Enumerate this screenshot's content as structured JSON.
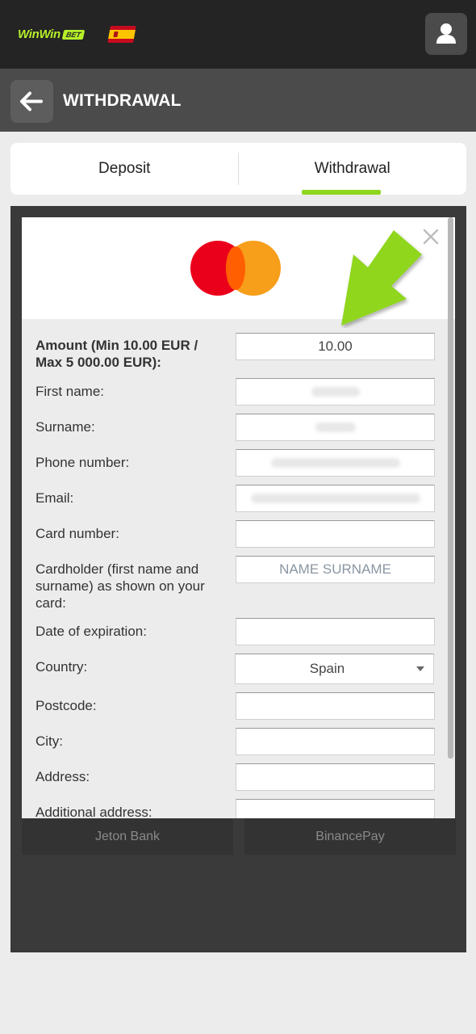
{
  "brand": {
    "name": "WinWin",
    "badge": "BET",
    "accent": "#b6f02a"
  },
  "header": {
    "title": "WITHDRAWAL",
    "back_icon": "arrow-left-icon",
    "user_icon": "user-icon"
  },
  "tabs": [
    {
      "label": "Deposit",
      "active": false
    },
    {
      "label": "Withdrawal",
      "active": true
    }
  ],
  "background_methods": [
    "Jeton Bank",
    "BinancePay"
  ],
  "modal": {
    "logo": "mastercard-logo",
    "close_icon": "close-icon",
    "fields": {
      "amount": {
        "label": "Amount (Min 10.00 EUR / Max 5 000.00 EUR):",
        "value": "10.00"
      },
      "first_name": {
        "label": "First name:"
      },
      "surname": {
        "label": "Surname:"
      },
      "phone": {
        "label": "Phone number:"
      },
      "email": {
        "label": "Email:"
      },
      "card_number": {
        "label": "Card number:",
        "value": ""
      },
      "cardholder": {
        "label": "Cardholder (first name and surname) as shown on your card:",
        "placeholder": "NAME SURNAME"
      },
      "expiration": {
        "label": "Date of expiration:",
        "value": ""
      },
      "country": {
        "label": "Country:",
        "value": "Spain"
      },
      "postcode": {
        "label": "Postcode:",
        "value": ""
      },
      "city": {
        "label": "City:",
        "value": ""
      },
      "address": {
        "label": "Address:",
        "value": ""
      },
      "additional_address": {
        "label": "Additional address:",
        "value": ""
      }
    }
  },
  "annotation": {
    "icon": "green-arrow-icon",
    "color": "#8fd61f"
  }
}
